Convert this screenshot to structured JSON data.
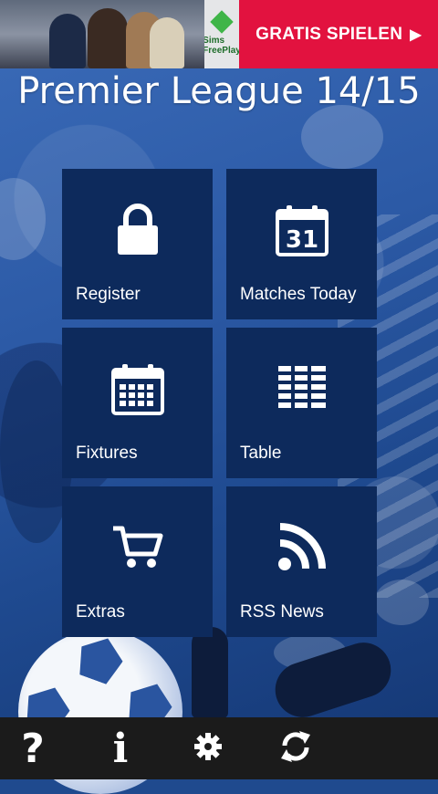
{
  "ad": {
    "logo_text": "Sims FreePlay",
    "cta_label": "GRATIS SPIELEN",
    "cta_icon": "play-arrow-icon",
    "cta_color": "#e2123f"
  },
  "title": "Premier League 14/15",
  "tiles": [
    {
      "label": "Register",
      "icon": "lock-icon"
    },
    {
      "label": "Matches Today",
      "icon": "calendar-31-icon",
      "icon_text": "31"
    },
    {
      "label": "Fixtures",
      "icon": "calendar-grid-icon"
    },
    {
      "label": "Table",
      "icon": "table-icon"
    },
    {
      "label": "Extras",
      "icon": "shopping-cart-icon"
    },
    {
      "label": "RSS News",
      "icon": "rss-icon"
    }
  ],
  "bottom_bar": {
    "help_label": "?",
    "info_label": "i",
    "settings_icon": "gear-icon",
    "refresh_icon": "refresh-icon"
  },
  "colors": {
    "tile": "#0d2a5c",
    "background": "#2c5aa6",
    "bottom_bar": "#1b1b1b"
  }
}
